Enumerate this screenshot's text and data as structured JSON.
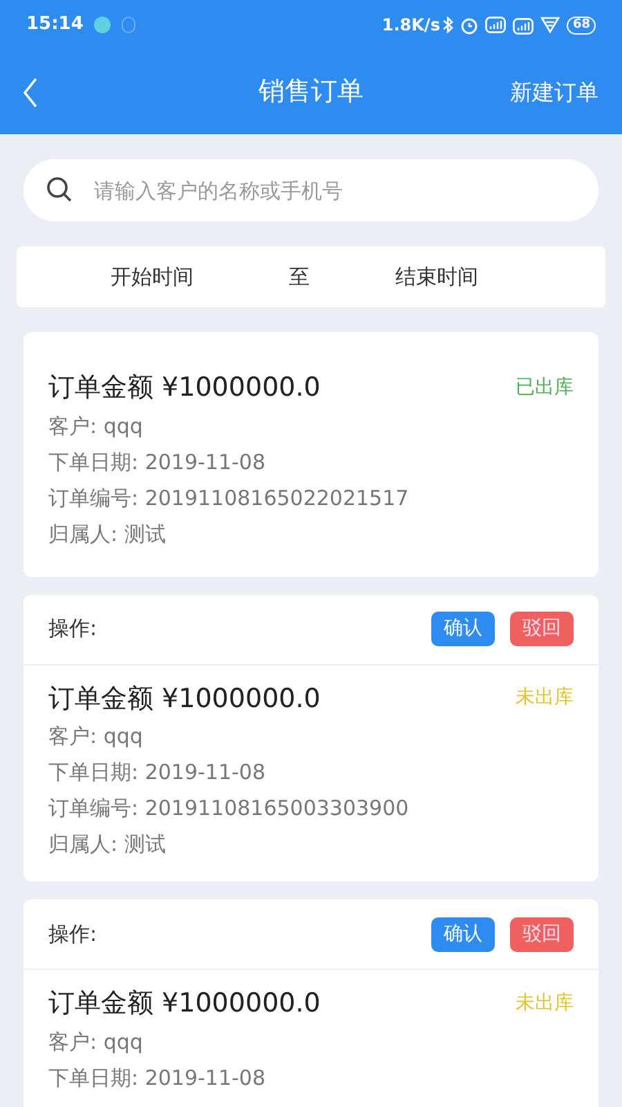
{
  "status_bar": {
    "time": "15:14",
    "speed": "1.8K/s",
    "battery": "68"
  },
  "nav": {
    "title": "销售订单",
    "action": "新建订单"
  },
  "search": {
    "placeholder": "请输入客户的名称或手机号"
  },
  "date_range": {
    "start": "开始时间",
    "separator": "至",
    "end": "结束时间"
  },
  "orders": [
    {
      "amount": "订单金额 ¥1000000.0",
      "status": {
        "text": "已出库",
        "color": "#4caf50"
      },
      "fields": [
        "客户: qqq",
        "下单日期: 2019-11-08",
        "订单编号: 20191108165022021517",
        "归属人: 测试"
      ]
    },
    {
      "actions": {
        "label": "操作:",
        "buttons": [
          {
            "label": "确认",
            "kind": "confirm"
          },
          {
            "label": "驳回",
            "kind": "reject"
          }
        ]
      },
      "amount": "订单金额 ¥1000000.0",
      "status": {
        "text": "未出库",
        "color": "#e6c229"
      },
      "fields": [
        "客户: qqq",
        "下单日期: 2019-11-08",
        "订单编号: 20191108165003303900",
        "归属人: 测试"
      ]
    },
    {
      "actions": {
        "label": "操作:",
        "buttons": [
          {
            "label": "确认",
            "kind": "confirm"
          },
          {
            "label": "驳回",
            "kind": "reject"
          }
        ]
      },
      "amount": "订单金额 ¥1000000.0",
      "status": {
        "text": "未出库",
        "color": "#e6c229"
      },
      "fields": [
        "客户: qqq",
        "下单日期: 2019-11-08"
      ]
    }
  ]
}
